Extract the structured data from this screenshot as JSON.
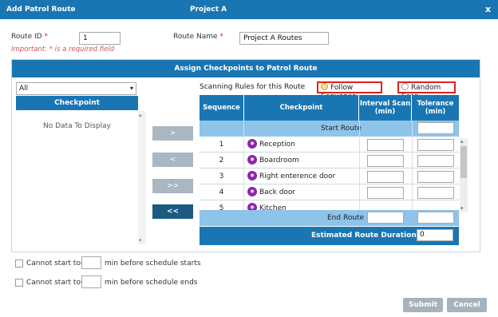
{
  "dialog": {
    "title": "Add Patrol Route",
    "project": "Project A",
    "close_icon": "close-icon",
    "close_glyph": "x"
  },
  "form": {
    "route_id_label": "Route ID",
    "route_id_value": "1",
    "route_name_label": "Route Name",
    "route_name_value": "Project A Routes",
    "required_marker": "*",
    "required_hint": "Important: * is a required field"
  },
  "assign": {
    "title": "Assign Checkpoints to Patrol Route",
    "filter_value": "All",
    "checkpoint_header": "Checkpoint",
    "empty_text": "No Data To Display",
    "move_buttons": [
      ">",
      "<",
      ">>",
      "<<"
    ]
  },
  "scanning": {
    "label": "Scanning Rules for this Route",
    "options": [
      "Follow Sequence",
      "Random Scan"
    ],
    "selected": "Follow Sequence"
  },
  "grid": {
    "headers": [
      "Sequence",
      "Checkpoint",
      "Interval Scan (min)",
      "Tolerance (min)"
    ],
    "start_label": "Start Route",
    "end_label": "End Route",
    "duration_label": "Estimated Route Duration (min)",
    "duration_value": "0",
    "rows": [
      {
        "seq": "1",
        "name": "Reception"
      },
      {
        "seq": "2",
        "name": "Boardroom"
      },
      {
        "seq": "3",
        "name": "Right enterence door"
      },
      {
        "seq": "4",
        "name": "Back door"
      },
      {
        "seq": "5",
        "name": "Kitchen"
      }
    ]
  },
  "options": {
    "start_text_a": "Cannot start tour",
    "start_text_b": "min before schedule starts",
    "end_text_a": "Cannot start tour",
    "end_text_b": "min before schedule ends"
  },
  "actions": {
    "submit": "Submit",
    "cancel": "Cancel"
  },
  "colors": {
    "header_blue": "#1a76b3",
    "row_highlight": "#8ec4ea",
    "required_red": "#d32f2f",
    "nfc_purple": "#8e24aa"
  }
}
